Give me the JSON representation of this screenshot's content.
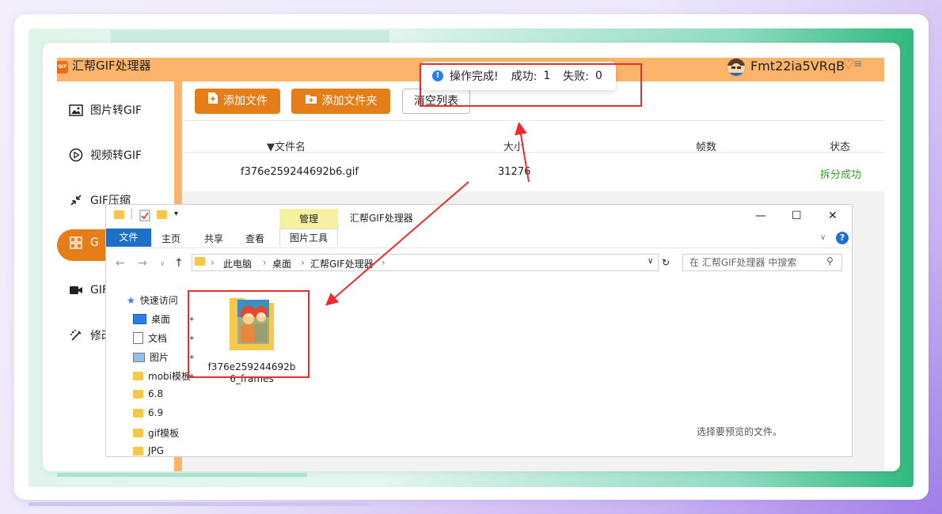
{
  "app": {
    "title": "汇帮GIF处理器",
    "logo_text": "GIF",
    "username": "Fmt22ia5VRqB"
  },
  "sidebar": {
    "items": [
      {
        "label": "图片转GIF",
        "icon": "image-icon"
      },
      {
        "label": "视频转GIF",
        "icon": "play-icon"
      },
      {
        "label": "GIF压缩",
        "icon": "compress-icon"
      },
      {
        "label": "G",
        "icon": "grid-icon"
      },
      {
        "label": "GIF",
        "icon": "camera-icon"
      },
      {
        "label": "修改",
        "icon": "edit-icon"
      }
    ]
  },
  "toolbar": {
    "add_file": "添加文件",
    "add_folder": "添加文件夹",
    "clear_list": "清空列表"
  },
  "table": {
    "headers": {
      "name": "文件名",
      "size": "大小",
      "frames": "帧数",
      "status": "状态"
    },
    "rows": [
      {
        "name": "f376e259244692b6.gif",
        "size": "31276",
        "frames": "",
        "status": "拆分成功"
      }
    ]
  },
  "toast": {
    "message": "操作完成!",
    "success_label": "成功:",
    "success_count": "1",
    "fail_label": "失败:",
    "fail_count": "0"
  },
  "explorer": {
    "title": "汇帮GIF处理器",
    "manage_tab": "管理",
    "ribbon_tabs": [
      "文件",
      "主页",
      "共享",
      "查看",
      "图片工具"
    ],
    "breadcrumb": [
      "此电脑",
      "桌面",
      "汇帮GIF处理器"
    ],
    "search_placeholder": "在 汇帮GIF处理器 中搜索",
    "tree": [
      "快速访问",
      "桌面",
      "文档",
      "图片",
      "mobi模板",
      "6.8",
      "6.9",
      "gif模板",
      "JPG"
    ],
    "folder_name": "f376e259244692b6_frames",
    "preview_hint": "选择要预览的文件。"
  },
  "colors": {
    "accent_orange": "#e57e18",
    "header_orange": "#fbb469",
    "success_green": "#2f9e2f",
    "annotation_red": "#ee2b2b",
    "explorer_blue": "#1e6fc6"
  }
}
